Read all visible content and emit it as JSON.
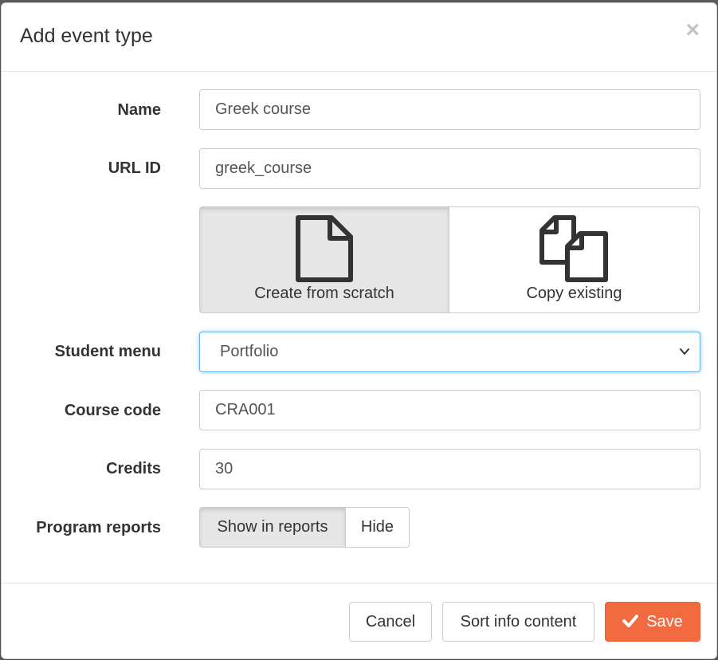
{
  "dialog": {
    "title": "Add event type",
    "close_label": "×"
  },
  "form": {
    "name": {
      "label": "Name",
      "value": "Greek course"
    },
    "url_id": {
      "label": "URL ID",
      "value": "greek_course"
    },
    "creation_mode": {
      "options": [
        {
          "label": "Create from scratch",
          "icon": "file-icon",
          "selected": true
        },
        {
          "label": "Copy existing",
          "icon": "copy-icon",
          "selected": false
        }
      ]
    },
    "student_menu": {
      "label": "Student menu",
      "value": "Portfolio"
    },
    "course_code": {
      "label": "Course code",
      "value": "CRA001"
    },
    "credits": {
      "label": "Credits",
      "value": "30"
    },
    "program_reports": {
      "label": "Program reports",
      "options": [
        {
          "label": "Show in reports",
          "selected": true
        },
        {
          "label": "Hide",
          "selected": false
        }
      ]
    }
  },
  "footer": {
    "cancel_label": "Cancel",
    "sort_label": "Sort info content",
    "save_label": "Save"
  },
  "colors": {
    "primary_button": "#f26a40",
    "focus_border": "#66afe9",
    "active_toggle": "#e6e6e6"
  }
}
